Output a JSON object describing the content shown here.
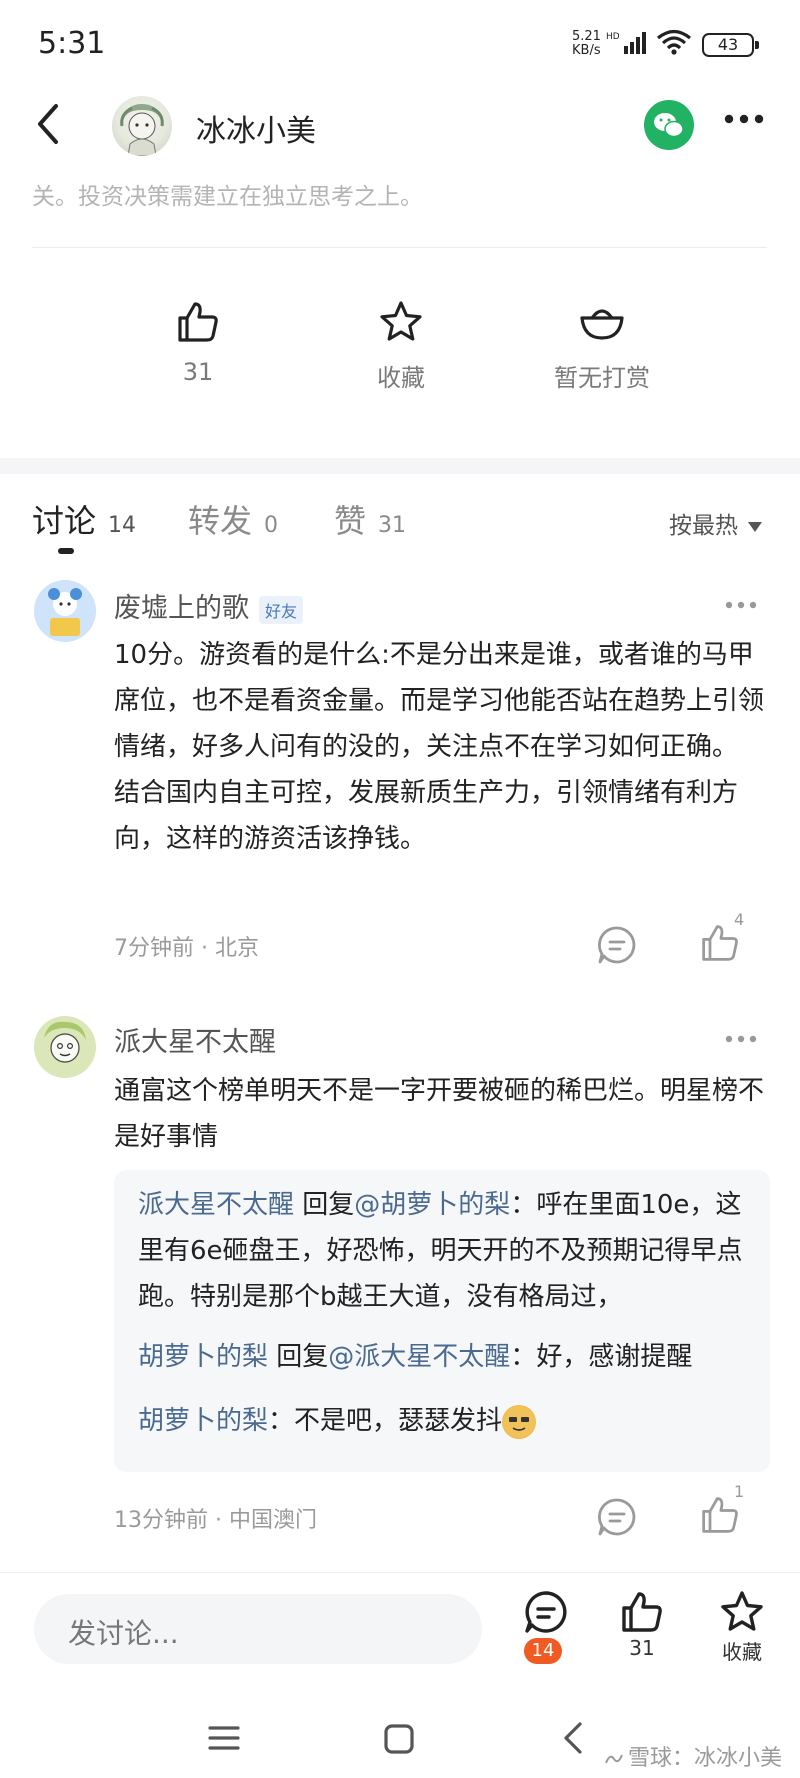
{
  "status": {
    "time": "5:31",
    "net_speed": "5.21",
    "net_unit": "KB/s",
    "battery": "43"
  },
  "header": {
    "username": "冰冰小美"
  },
  "disclaimer": "关。投资决策需建立在独立思考之上。",
  "actions": {
    "like_count": "31",
    "favorite_label": "收藏",
    "reward_label": "暂无打赏"
  },
  "tabs": [
    {
      "label": "讨论",
      "count": "14"
    },
    {
      "label": "转发",
      "count": "0"
    },
    {
      "label": "赞",
      "count": "31"
    }
  ],
  "sort_label": "按最热",
  "comments": [
    {
      "name": "废墟上的歌",
      "badge": "好友",
      "text": "10分。游资看的是什么:不是分出来是谁，或者谁的马甲席位，也不是看资金量。而是学习他能否站在趋势上引领情绪，好多人问有的没的，关注点不在学习如何正确。\n结合国内自主可控，发展新质生产力，引领情绪有利方向，这样的游资活该挣钱。",
      "meta": "7分钟前 · 北京",
      "likes": "4"
    },
    {
      "name": "派大星不太醒",
      "text": "通富这个榜单明天不是一字开要被砸的稀巴烂。明星榜不是好事情",
      "replies": [
        {
          "from": "派大星不太醒",
          "reply_word": "回复",
          "to": "@胡萝卜的梨",
          "text": "：呼在里面10e，这里有6e砸盘王，好恐怖，明天开的不及预期记得早点跑。特别是那个b越王大道，没有格局过，"
        },
        {
          "from": "胡萝卜的梨",
          "reply_word": "回复",
          "to": "@派大星不太醒",
          "text": "：好，感谢提醒"
        },
        {
          "from": "胡萝卜的梨",
          "text": "：不是吧，瑟瑟发抖"
        }
      ],
      "meta": "13分钟前 · 中国澳门",
      "likes": "1"
    }
  ],
  "bottom": {
    "input_placeholder": "发讨论...",
    "comment_count": "14",
    "like_count": "31",
    "favorite_label": "收藏"
  },
  "watermark": "雪球：冰冰小美",
  "colors": {
    "accent": "#f05a23",
    "link": "#4b6a8f",
    "wechat": "#21b263"
  }
}
